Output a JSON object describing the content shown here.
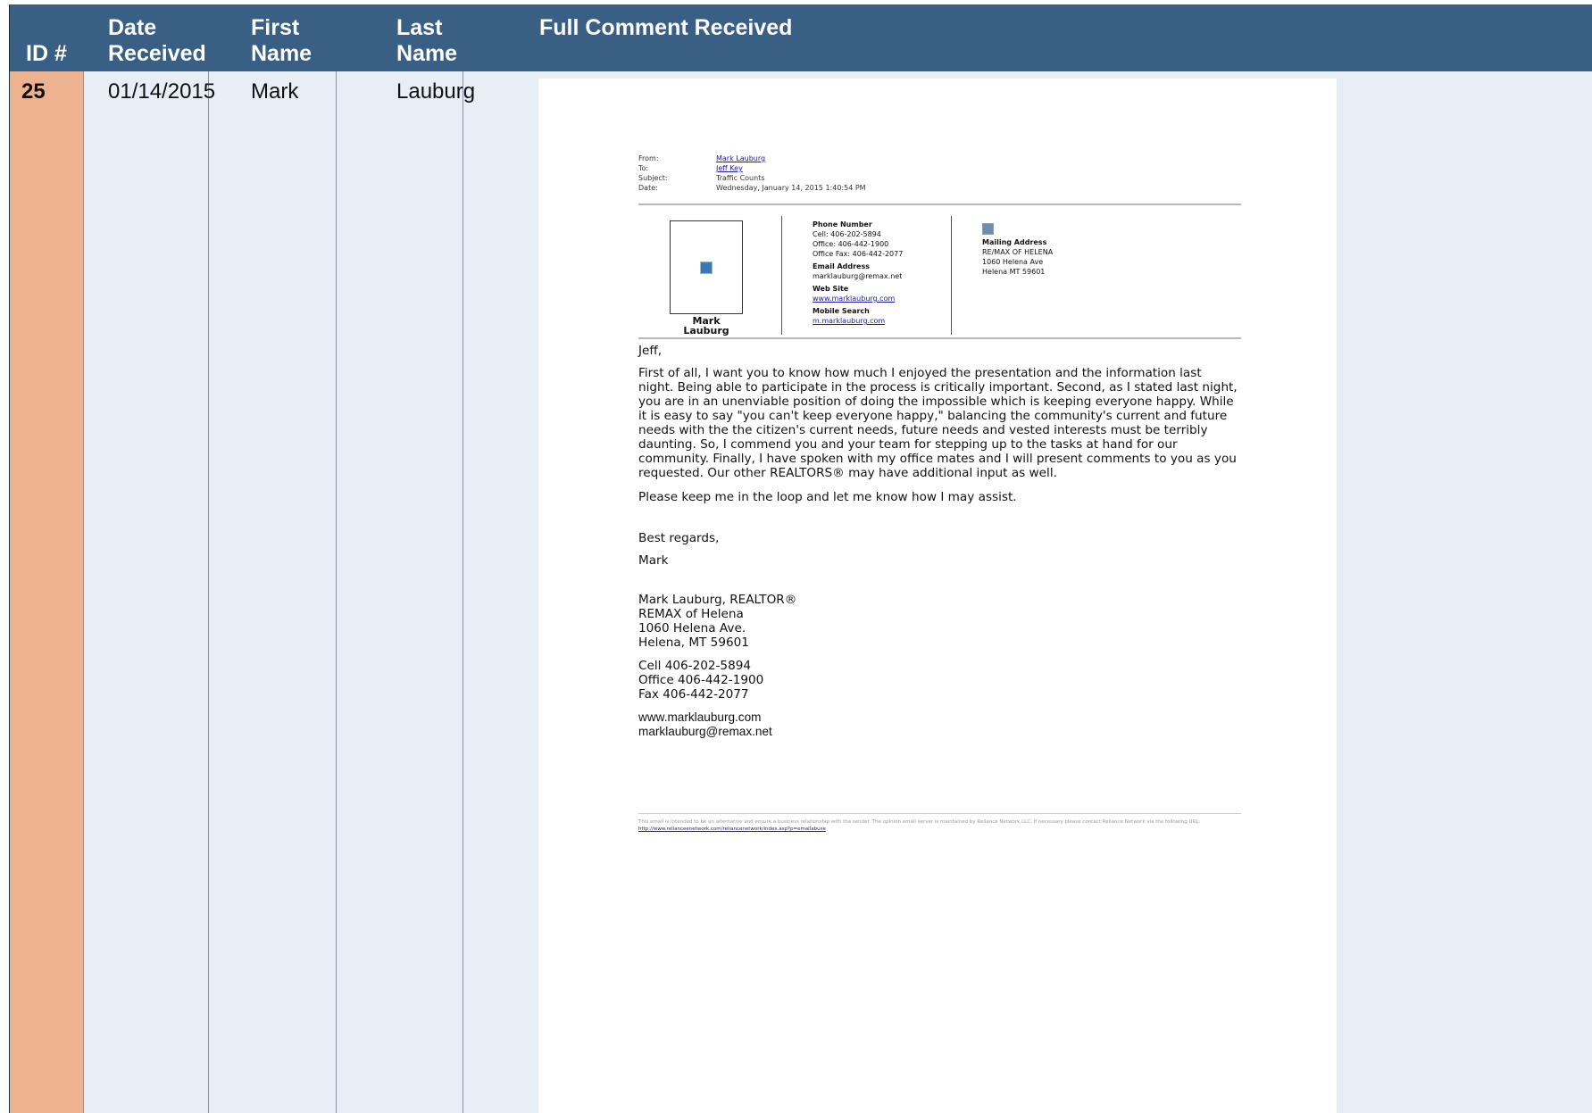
{
  "header": {
    "id": "ID #",
    "date": "Date Received",
    "first": "First Name",
    "last": "Last Name",
    "comment": "Full Comment Received"
  },
  "row": {
    "id": "25",
    "date": "01/14/2015",
    "first": "Mark",
    "last": "Lauburg"
  },
  "email": {
    "meta": [
      {
        "label": "From:",
        "value": "Mark Lauburg"
      },
      {
        "label": "To:",
        "value": "Jeff Key"
      },
      {
        "label": "Subject:",
        "value": "Traffic Counts"
      },
      {
        "label": "Date:",
        "value": "Wednesday, January 14, 2015 1:40:54 PM"
      }
    ],
    "card": {
      "name": "Mark Lauburg",
      "phone_title": "Phone Number",
      "cell": "Cell: 406-202-5894",
      "office": "Office: 406-442-1900",
      "fax": "Office Fax: 406-442-2077",
      "email_title": "Email Address",
      "email": "marklauburg@remax.net",
      "web_title": "Web Site",
      "web": "www.marklauburg.com",
      "mobile_title": "Mobile Search",
      "mobile": "m.marklauburg.com",
      "mail_title": "Mailing Address",
      "mail_1": "RE/MAX OF HELENA",
      "mail_2": "1060 Helena Ave",
      "mail_3": "Helena MT 59601"
    },
    "greeting": "Jeff,",
    "para1": "First of all, I want you to know how much I enjoyed the presentation and the information last night.  Being able to participate in the process is critically important.  Second, as I stated last night, you are in an unenviable position of doing the impossible which is keeping everyone happy.  While it is easy to say \"you can't keep everyone happy,\" balancing the community's current and future needs with the the citizen's current needs, future needs and vested interests must be terribly daunting. So, I commend you and your team for stepping up to the tasks at hand for our community.  Finally, I have spoken with my office mates and I will present comments to you as you requested.  Our other REALTORS® may have additional input as well.",
    "para2": "Please keep me in the loop and let me know how I may assist.",
    "closing": "Best regards,",
    "sign": "Mark",
    "sig1": "Mark Lauburg, REALTOR®",
    "sig2": "REMAX of Helena",
    "sig3": "1060 Helena Ave.",
    "sig4": "Helena, MT 59601",
    "sig5": "Cell 406-202-5894",
    "sig6": "Office 406-442-1900",
    "sig7": "Fax 406-442-2077",
    "sig8": "www.marklauburg.com",
    "sig9": "marklauburg@remax.net",
    "footer": "This email is intended to be an alternative and ensure a business relationship with the sender. The opinion email server is maintained by Reliance Network LLC. If necessary please contact Reliance Network via the following URL:",
    "footer_link": "http://www.relianceenetwork.com/reliancenetwork/index.asp?p=emailabuse"
  },
  "colors": {
    "header_bg": "#3a5f84",
    "id_col": "#edb28f",
    "body_col": "#e8eef5"
  }
}
